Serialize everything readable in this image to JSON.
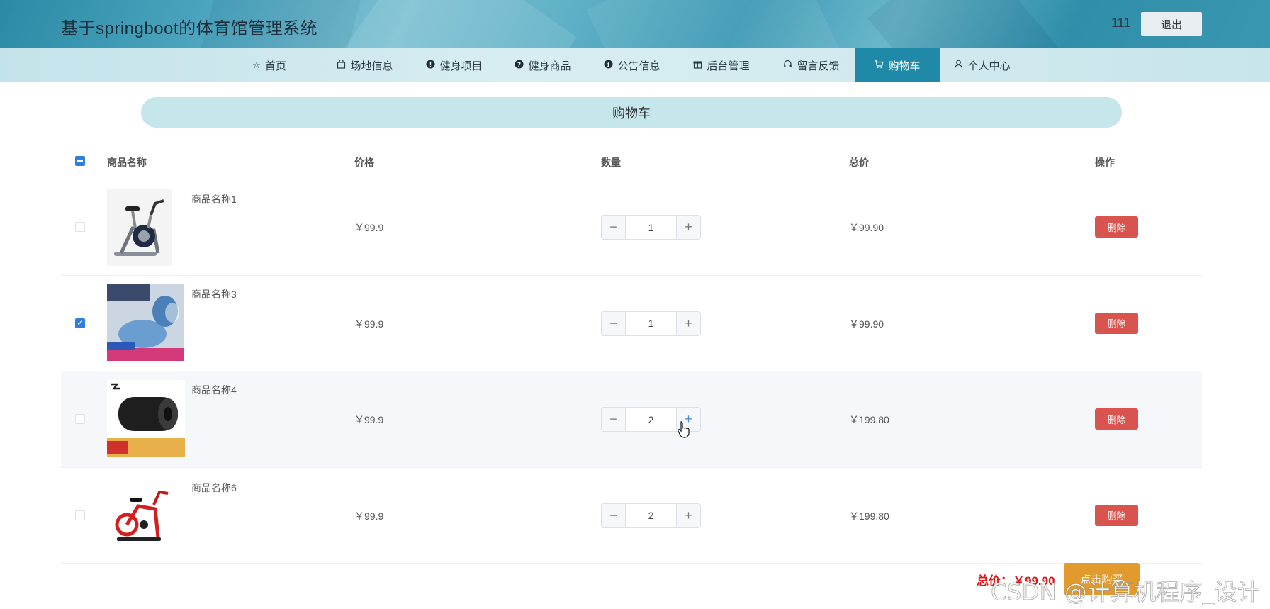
{
  "header": {
    "title": "基于springboot的体育馆管理系统",
    "username": "111",
    "logout_label": "退出"
  },
  "nav": {
    "items": [
      {
        "label": "首页",
        "icon": "star-icon"
      },
      {
        "label": "场地信息",
        "icon": "bag-icon"
      },
      {
        "label": "健身项目",
        "icon": "exclamation-icon"
      },
      {
        "label": "健身商品",
        "icon": "question-icon"
      },
      {
        "label": "公告信息",
        "icon": "info-icon"
      },
      {
        "label": "后台管理",
        "icon": "gift-icon"
      },
      {
        "label": "留言反馈",
        "icon": "headset-icon"
      },
      {
        "label": "购物车",
        "icon": "cart-icon",
        "active": true
      },
      {
        "label": "个人中心",
        "icon": "user-icon"
      }
    ]
  },
  "page": {
    "title": "购物车"
  },
  "table": {
    "headers": {
      "name": "商品名称",
      "price": "价格",
      "quantity": "数量",
      "total": "总价",
      "action": "操作"
    },
    "rows": [
      {
        "name": "商品名称1",
        "price": "￥99.9",
        "quantity": "1",
        "total": "￥99.90",
        "checked": false,
        "image": "exercise-bike-black"
      },
      {
        "name": "商品名称3",
        "price": "￥99.9",
        "quantity": "1",
        "total": "￥99.90",
        "checked": true,
        "image": "seat-cushion-product"
      },
      {
        "name": "商品名称4",
        "price": "￥99.9",
        "quantity": "2",
        "total": "￥199.80",
        "checked": false,
        "image": "foam-roller-product"
      },
      {
        "name": "商品名称6",
        "price": "￥99.9",
        "quantity": "2",
        "total": "￥199.80",
        "checked": false,
        "image": "exercise-bike-red"
      }
    ],
    "delete_label": "删除"
  },
  "footer": {
    "total_label": "总价：￥99.90",
    "checkout_label": "点击购买"
  },
  "watermark": "CSDN @计算机程序_设计",
  "colors": {
    "accent": "#1f8aa8",
    "danger": "#d9534f",
    "checkout": "#e19a2b",
    "total_text": "#e0161a",
    "checkbox": "#2f7fe0"
  }
}
